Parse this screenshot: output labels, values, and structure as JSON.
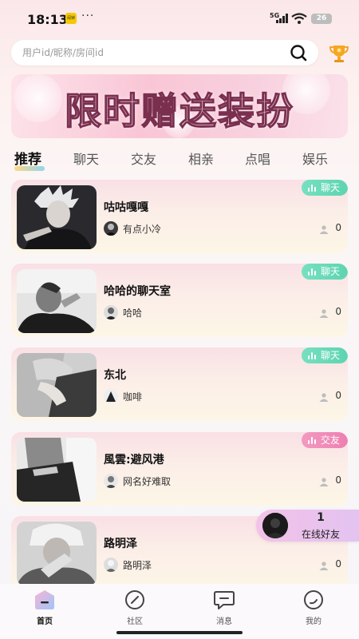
{
  "status_bar": {
    "time": "18:13",
    "app_badge": "闹钟",
    "more": "···",
    "network": "5G",
    "battery": "26"
  },
  "search": {
    "placeholder": "用户id/昵称/房间id"
  },
  "banner": {
    "title": "限时赠送装扮"
  },
  "tabs": [
    {
      "label": "推荐",
      "active": true
    },
    {
      "label": "聊天"
    },
    {
      "label": "交友"
    },
    {
      "label": "相亲"
    },
    {
      "label": "点唱"
    },
    {
      "label": "娱乐"
    }
  ],
  "rooms": [
    {
      "title": "咕咕嘎嘎",
      "host": "有点小冷",
      "tag": "聊天",
      "listeners": "0",
      "tag_color": "#5ed4b1"
    },
    {
      "title": "哈哈的聊天室",
      "host": "哈哈",
      "tag": "聊天",
      "listeners": "0",
      "tag_color": "#5ed4b1"
    },
    {
      "title": "东北",
      "host": "咖啡",
      "tag": "聊天",
      "listeners": "0",
      "tag_color": "#5ed4b1"
    },
    {
      "title": "風雲:避风港",
      "host": "网名好难取",
      "tag": "交友",
      "listeners": "0",
      "tag_color": "#ee7fb0"
    },
    {
      "title": "路明泽",
      "host": "路明泽",
      "tag": "",
      "listeners": "0"
    }
  ],
  "online_friends": {
    "count": "1",
    "label": "在线好友"
  },
  "bottom_nav": [
    {
      "label": "首页",
      "icon": "home-icon",
      "active": true
    },
    {
      "label": "社区",
      "icon": "compass-icon"
    },
    {
      "label": "消息",
      "icon": "message-icon"
    },
    {
      "label": "我的",
      "icon": "profile-icon"
    }
  ]
}
